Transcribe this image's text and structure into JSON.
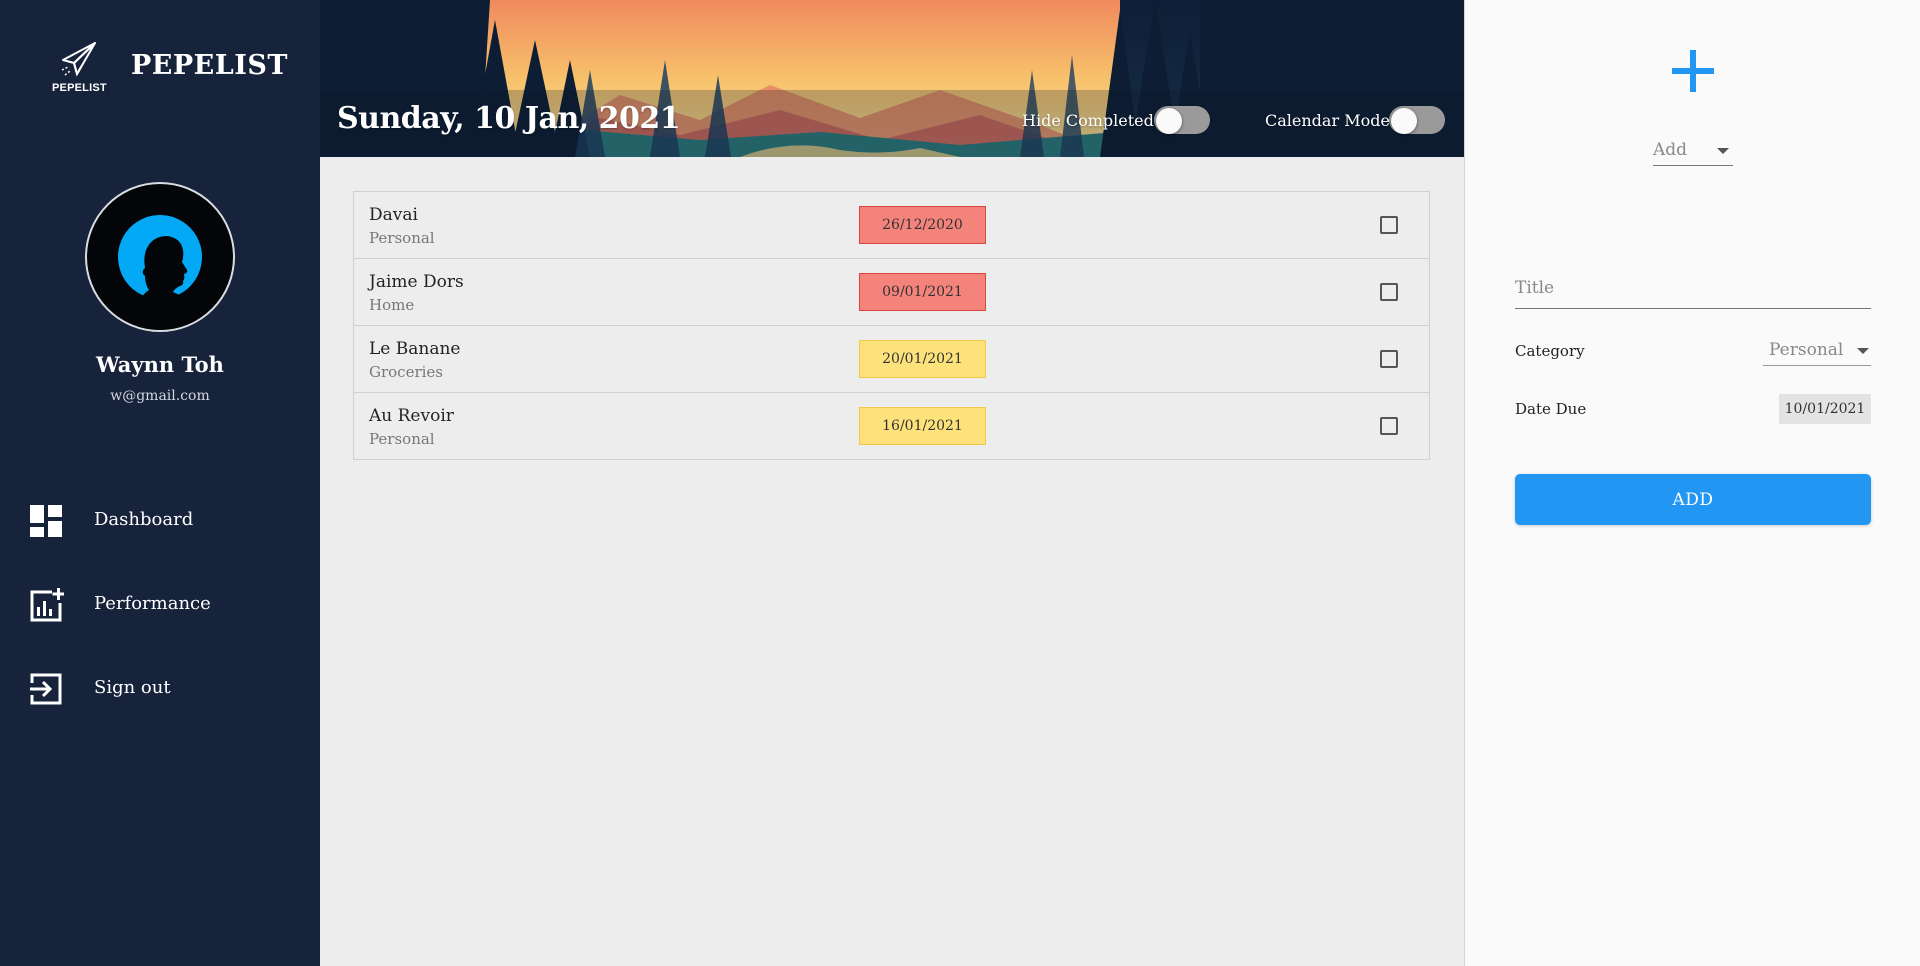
{
  "app": {
    "name": "PEPELIST",
    "logo_text": "PEPELIST"
  },
  "user": {
    "name": "Waynn Toh",
    "email": "w@gmail.com"
  },
  "nav": {
    "items": [
      {
        "label": "Dashboard",
        "icon": "dashboard-icon"
      },
      {
        "label": "Performance",
        "icon": "performance-icon"
      },
      {
        "label": "Sign out",
        "icon": "sign-out-icon"
      }
    ]
  },
  "header": {
    "date": "Sunday, 10 Jan, 2021",
    "hide_completed_label": "Hide Completed",
    "hide_completed_on": false,
    "calendar_mode_label": "Calendar Mode",
    "calendar_mode_on": false
  },
  "tasks": [
    {
      "title": "Davai",
      "category": "Personal",
      "due": "26/12/2020",
      "status": "overdue",
      "done": false
    },
    {
      "title": "Jaime Dors",
      "category": "Home",
      "due": "09/01/2021",
      "status": "overdue",
      "done": false
    },
    {
      "title": "Le Banane",
      "category": "Groceries",
      "due": "20/01/2021",
      "status": "upcoming",
      "done": false
    },
    {
      "title": "Au Revoir",
      "category": "Personal",
      "due": "16/01/2021",
      "status": "upcoming",
      "done": false
    }
  ],
  "form": {
    "mode": "Add",
    "title_placeholder": "Title",
    "title_value": "",
    "category_label": "Category",
    "category_value": "Personal",
    "date_label": "Date Due",
    "date_value": "10/01/2021",
    "submit_label": "ADD"
  },
  "colors": {
    "sidebar": "#17223b",
    "accent": "#2196f3",
    "overdue": "#f4837b",
    "upcoming": "#fde27b",
    "avatar_circle": "#03a9f4"
  }
}
